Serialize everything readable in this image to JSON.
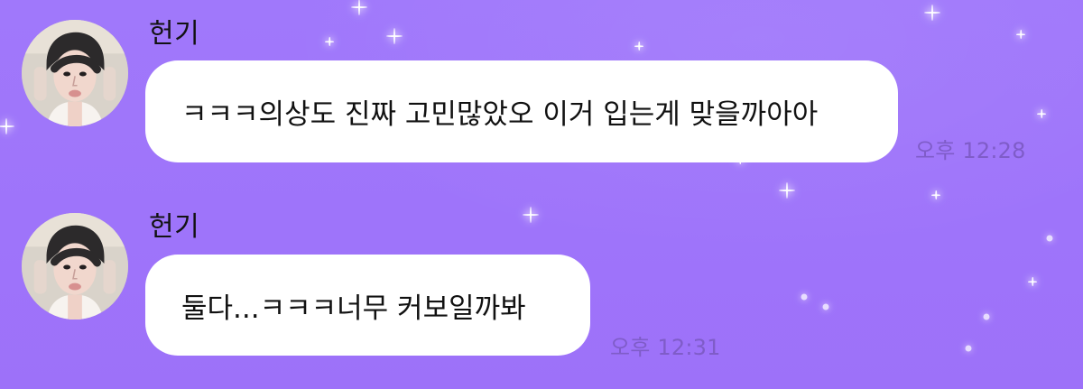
{
  "messages": [
    {
      "sender": "헌기",
      "text": "ㅋㅋㅋ의상도 진짜 고민많았오 이거 입는게 맞을까아아",
      "time": "오후 12:28"
    },
    {
      "sender": "헌기",
      "text": "둘다...ㅋㅋㅋ너무 커보일까봐",
      "time": "오후 12:31"
    }
  ],
  "theme": {
    "background": "#9f74fb",
    "bubble": "#ffffff",
    "timestamp": "#7f5cc8",
    "name_text": "#121212"
  }
}
